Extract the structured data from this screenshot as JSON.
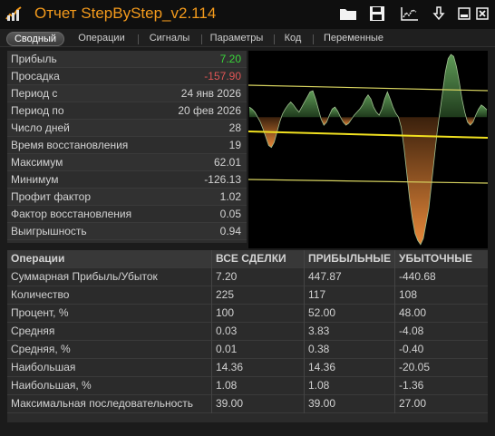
{
  "app": {
    "title": "Отчет StepByStep_v2.114",
    "title_color": "#f39a1c",
    "icons": [
      "folder-icon",
      "save-icon",
      "chart-export-icon",
      "download-icon",
      "minimize-icon",
      "close-icon"
    ]
  },
  "tabs": [
    {
      "label": "Сводный",
      "active": true
    },
    {
      "label": "Операции",
      "active": false
    },
    {
      "label": "Сигналы",
      "active": false
    },
    {
      "label": "Параметры",
      "active": false
    },
    {
      "label": "Код",
      "active": false
    },
    {
      "label": "Переменные",
      "active": false
    }
  ],
  "summary": [
    {
      "label": "Прибыль",
      "value": "7.20",
      "color": "#39d639"
    },
    {
      "label": "Просадка",
      "value": "-157.90",
      "color": "#e05555"
    },
    {
      "label": "Период с",
      "value": "24 янв 2026"
    },
    {
      "label": "Период по",
      "value": "20 фев 2026"
    },
    {
      "label": "Число дней",
      "value": "28"
    },
    {
      "label": "Время восстановления",
      "value": "19"
    },
    {
      "label": "Максимум",
      "value": "62.01"
    },
    {
      "label": "Минимум",
      "value": "-126.13"
    },
    {
      "label": "Профит фактор",
      "value": "1.02"
    },
    {
      "label": "Фактор восстановления",
      "value": "0.05"
    },
    {
      "label": "Выигрышность",
      "value": "0.94"
    }
  ],
  "operations": {
    "headers": [
      "Операции",
      "ВСЕ СДЕЛКИ",
      "ПРИБЫЛЬНЫЕ",
      "УБЫТОЧНЫЕ"
    ],
    "rows": [
      [
        "Суммарная Прибыль/Убыток",
        "7.20",
        "447.87",
        "-440.68"
      ],
      [
        "Количество",
        "225",
        "117",
        "108"
      ],
      [
        "Процент, %",
        "100",
        "52.00",
        "48.00"
      ],
      [
        "Средняя",
        "0.03",
        "3.83",
        "-4.08"
      ],
      [
        "Средняя, %",
        "0.01",
        "0.38",
        "-0.40"
      ],
      [
        "Наибольшая",
        "14.36",
        "14.36",
        "-20.05"
      ],
      [
        "Наибольшая, %",
        "1.08",
        "1.08",
        "-1.36"
      ],
      [
        "Максимальная последовательность",
        "39.00",
        "39.00",
        "27.00"
      ]
    ]
  },
  "chart_data": {
    "type": "area",
    "series": [
      {
        "values": [
          10,
          8,
          5,
          0,
          -5,
          -12,
          -20,
          -28,
          -30,
          -25,
          -15,
          -5,
          3,
          8,
          12,
          15,
          12,
          8,
          5,
          10,
          15,
          20,
          25,
          26,
          18,
          8,
          -2,
          -8,
          -5,
          2,
          8,
          10,
          6,
          0,
          -5,
          -8,
          -6,
          -2,
          2,
          5,
          8,
          12,
          18,
          22,
          18,
          10,
          5,
          2,
          8,
          18,
          25,
          18,
          10,
          4,
          0,
          -10,
          -30,
          -55,
          -80,
          -100,
          -115,
          -122,
          -126,
          -120,
          -105,
          -90,
          -65,
          -40,
          -15,
          5,
          25,
          45,
          58,
          62,
          60,
          50,
          35,
          18,
          5,
          -5,
          -8,
          -5,
          2,
          8,
          12,
          10,
          7.2
        ]
      }
    ],
    "ylim": [
      -126.13,
      62.01
    ],
    "reference_lines": [
      {
        "color": "#d8d460"
      },
      {
        "color": "#f0e020"
      },
      {
        "color": "#d8d460"
      }
    ],
    "positive_color": "#4a7a44",
    "negative_color": "#d67f34",
    "grid": false
  }
}
